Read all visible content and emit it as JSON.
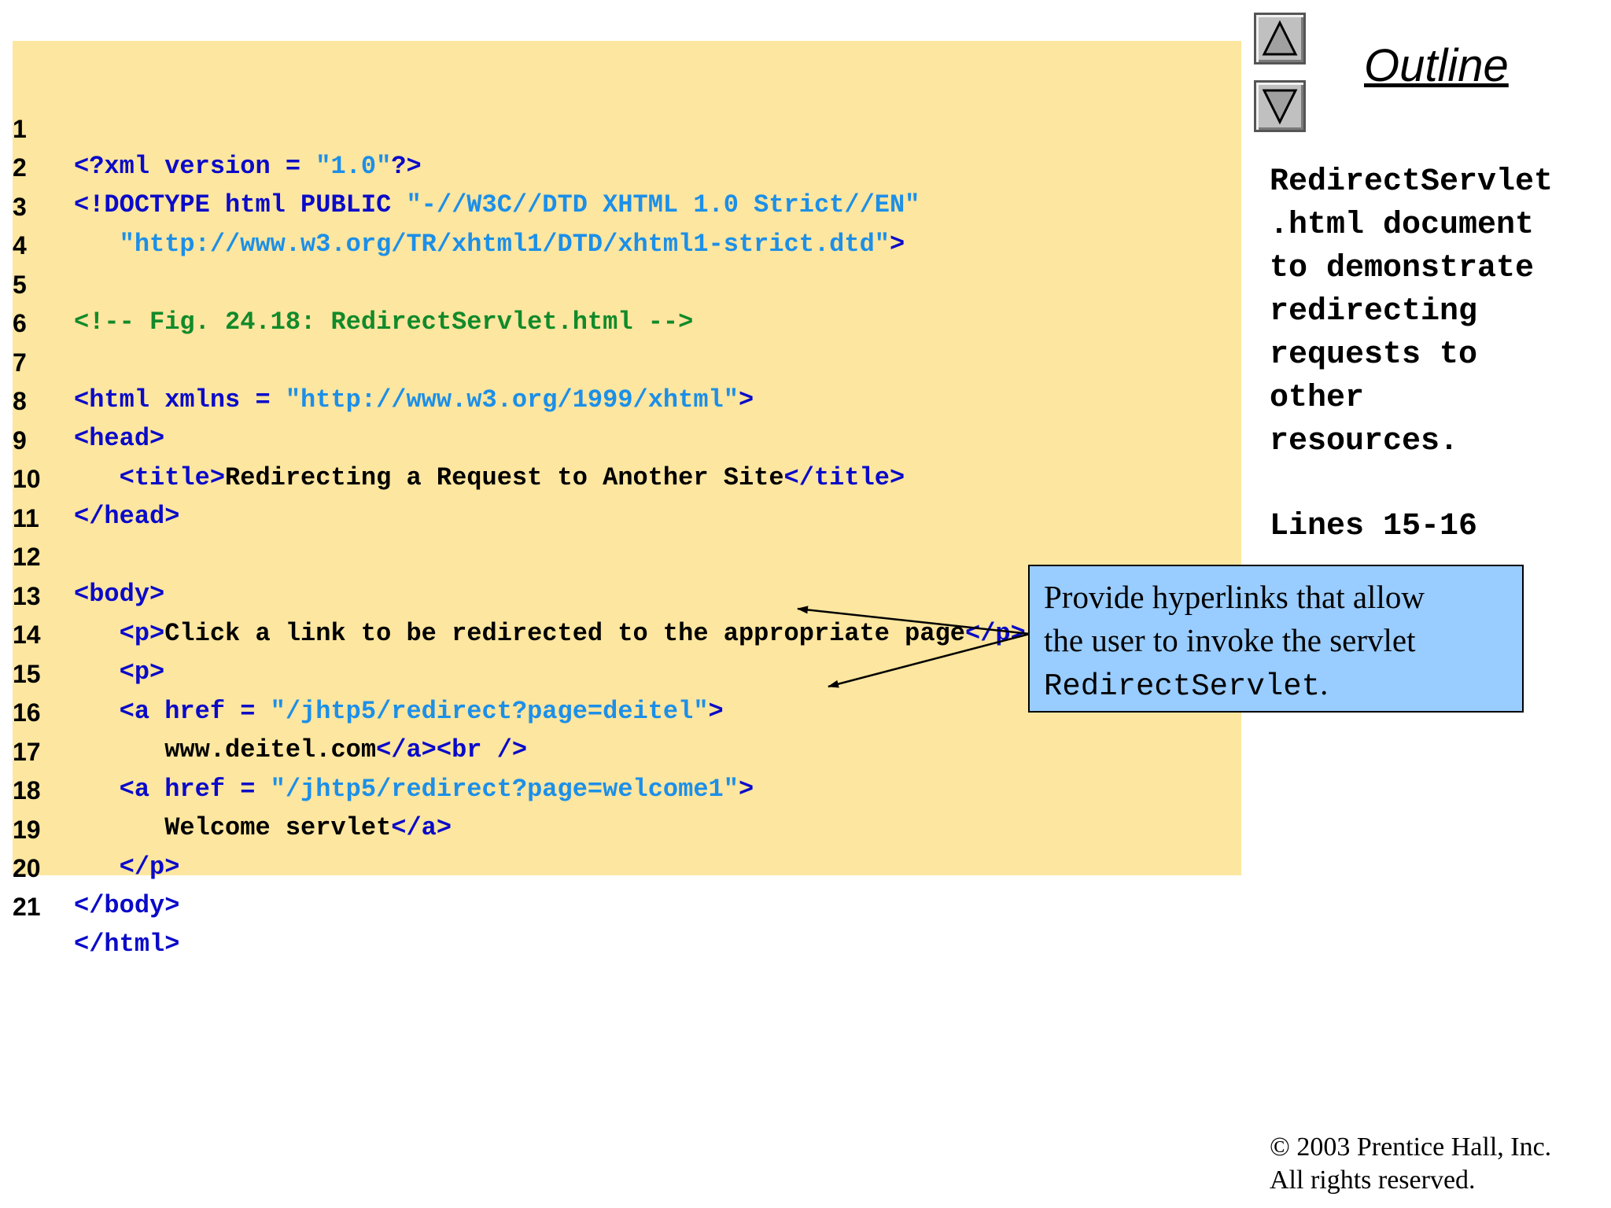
{
  "code": {
    "line_numbers": [
      "1",
      "2",
      "3",
      "4",
      "5",
      "6",
      "7",
      "8",
      "9",
      "10",
      "11",
      "12",
      "13",
      "14",
      "15",
      "16",
      "17",
      "18",
      "19",
      "20",
      "21"
    ],
    "line1": {
      "a": "<?xml version = ",
      "b": "\"1.0\"",
      "c": "?>"
    },
    "line2": {
      "a": "<!DOCTYPE html PUBLIC ",
      "b": "\"-//W3C//DTD XHTML 1.0 Strict//EN\""
    },
    "line3": {
      "a": "   \"http://www.w3.org/TR/xhtml1/DTD/xhtml1-strict.dtd\"",
      "b": ">"
    },
    "line5": "<!-- Fig. 24.18: RedirectServlet.html -->",
    "line7": {
      "a": "<html xmlns = ",
      "b": "\"http://www.w3.org/1999/xhtml\"",
      "c": ">"
    },
    "line8": "<head>",
    "line9": {
      "a": "   <title>",
      "b": "Redirecting a Request to Another Site",
      "c": "</title>"
    },
    "line10": "</head>",
    "line12": "<body>",
    "line13": {
      "a": "   <p>",
      "b": "Click a link to be redirected to the appropriate page",
      "c": "</p>"
    },
    "line14": "   <p>",
    "line15": {
      "a": "   <a href = ",
      "b": "\"/jhtp5/redirect?page=deitel\"",
      "c": ">"
    },
    "line16": {
      "a": "      www.deitel.com",
      "b": "</a><br />"
    },
    "line17": {
      "a": "   <a href = ",
      "b": "\"/jhtp5/redirect?page=welcome1\"",
      "c": ">"
    },
    "line18": {
      "a": "      Welcome servlet",
      "b": "</a>"
    },
    "line19": "   </p>",
    "line20": "</body>",
    "line21": "</html>"
  },
  "sidebar": {
    "outline_title": "Outline",
    "description_lines": [
      "RedirectServlet",
      ".html document",
      "to demonstrate",
      "redirecting",
      "requests to",
      "other",
      "resources."
    ],
    "lines_ref": "Lines 15-16",
    "up_icon": "triangle-up-icon",
    "down_icon": "triangle-down-icon"
  },
  "callout": {
    "text_line1": "Provide hyperlinks that allow",
    "text_line2": "the user to invoke the servlet",
    "code_word": "RedirectServlet",
    "period": "."
  },
  "colors": {
    "code_background": "#fde69f",
    "tag": "#0a0ac9",
    "string": "#1c8fe8",
    "comment": "#118a2a",
    "callout_background": "#99ccff"
  },
  "footer": {
    "copyright_line1": "© 2003 Prentice Hall, Inc.",
    "copyright_line2": "All rights reserved."
  }
}
